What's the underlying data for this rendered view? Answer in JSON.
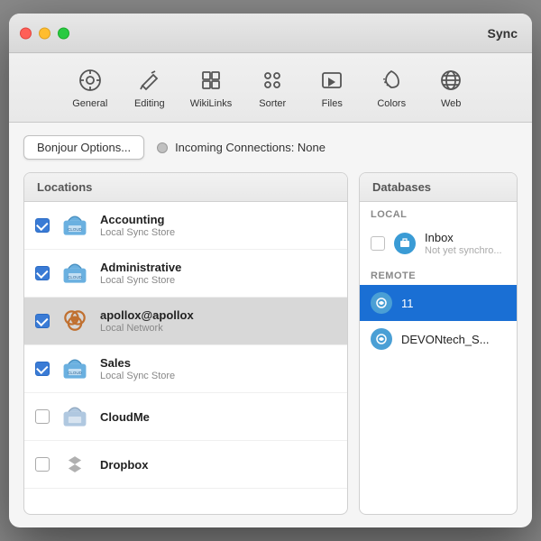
{
  "window": {
    "title": "Sync"
  },
  "toolbar": {
    "items": [
      {
        "id": "general",
        "label": "General"
      },
      {
        "id": "editing",
        "label": "Editing"
      },
      {
        "id": "wikilinks",
        "label": "WikiLinks"
      },
      {
        "id": "sorter",
        "label": "Sorter"
      },
      {
        "id": "files",
        "label": "Files"
      },
      {
        "id": "colors",
        "label": "Colors"
      },
      {
        "id": "web",
        "label": "Web"
      }
    ]
  },
  "topbar": {
    "bonjour_button": "Bonjour Options...",
    "status_label": "Incoming Connections: None"
  },
  "locations_panel": {
    "header": "Locations",
    "items": [
      {
        "name": "Accounting",
        "sub": "Local Sync Store",
        "checked": true,
        "selected": false,
        "type": "cloud"
      },
      {
        "name": "Administrative",
        "sub": "Local Sync Store",
        "checked": true,
        "selected": false,
        "type": "cloud"
      },
      {
        "name": "apollox@apollox",
        "sub": "Local Network",
        "checked": true,
        "selected": true,
        "type": "network"
      },
      {
        "name": "Sales",
        "sub": "Local Sync Store",
        "checked": true,
        "selected": false,
        "type": "cloud"
      },
      {
        "name": "CloudMe",
        "sub": "",
        "checked": false,
        "selected": false,
        "type": "cloudme"
      },
      {
        "name": "Dropbox",
        "sub": "",
        "checked": false,
        "selected": false,
        "type": "dropbox"
      }
    ]
  },
  "databases_panel": {
    "header": "Databases",
    "local_label": "LOCAL",
    "remote_label": "REMOTE",
    "local_items": [
      {
        "name": "Inbox",
        "sub": "Not yet synchro...",
        "selected": false
      }
    ],
    "remote_items": [
      {
        "name": "11",
        "selected": true
      },
      {
        "name": "DEVONtech_S...",
        "selected": false
      }
    ]
  }
}
